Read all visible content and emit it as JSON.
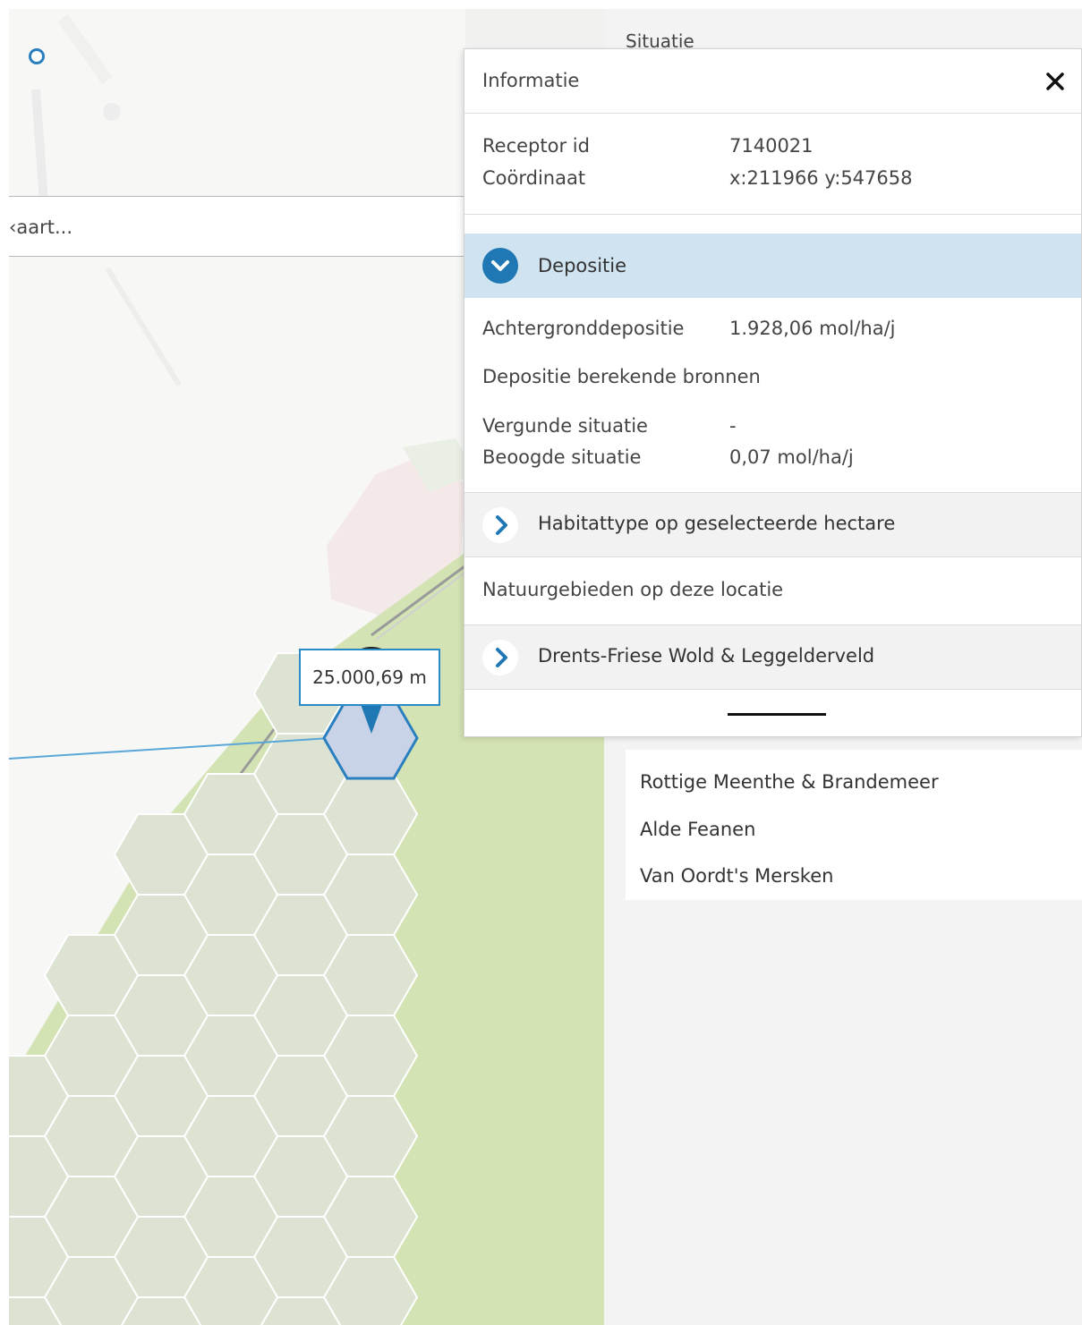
{
  "map": {
    "search_placeholder": "‹aart...",
    "distance_label": "25.000,69 m"
  },
  "background_panel": {
    "situatie_label": "Situatie",
    "nature_areas": [
      "Rottige Meenthe & Brandemeer",
      "Alde Feanen",
      "Van Oordt's Mersken"
    ]
  },
  "info": {
    "title": "Informatie",
    "close_symbol": "✕",
    "receptor_id_label": "Receptor id",
    "receptor_id_value": "7140021",
    "coordinate_label": "Coördinaat",
    "coordinate_value": "x:211966 y:547658",
    "deposition_section": "Depositie",
    "background_deposition_label": "Achtergronddepositie",
    "background_deposition_value": "1.928,06 mol/ha/j",
    "calculated_sources_label": "Depositie berekende bronnen",
    "permitted_situation_label": "Vergunde situatie",
    "permitted_situation_value": "-",
    "intended_situation_label": "Beoogde situatie",
    "intended_situation_value": "0,07 mol/ha/j",
    "habitat_section": "Habitattype op geselecteerde hectare",
    "nature_areas_label": "Natuurgebieden op deze locatie",
    "nature_area_section": "Drents-Friese Wold & Leggelderveld"
  },
  "colors": {
    "accent": "#1f78b4",
    "active_section_bg": "#cfe3f0",
    "collapsed_section_bg": "#f2f2f2",
    "hexagon_fill": "#dce3d2",
    "nature_area_fill": "#d4e3b4"
  },
  "icons": {
    "expanded": "chevron-down-icon",
    "collapsed": "chevron-right-icon",
    "close": "close-icon",
    "marker": "map-marker-icon"
  }
}
